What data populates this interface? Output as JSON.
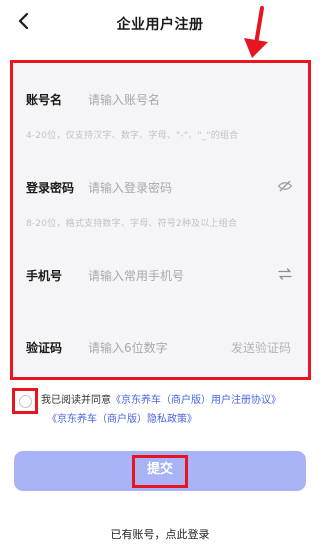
{
  "header": {
    "title": "企业用户注册"
  },
  "form": {
    "account": {
      "label": "账号名",
      "placeholder": "请输入账号名",
      "hint": "4-20位，仅支持汉字、数字、字母、\"-\"、\"_\"的组合"
    },
    "password": {
      "label": "登录密码",
      "placeholder": "请输入登录密码",
      "hint": "8-20位，格式支持数字、字母、符号2种及以上组合"
    },
    "phone": {
      "label": "手机号",
      "placeholder": "请输入常用手机号"
    },
    "code": {
      "label": "验证码",
      "placeholder": "请输入6位数字",
      "send_label": "发送验证码"
    }
  },
  "agreement": {
    "prefix": "我已阅读并同意",
    "link1": "《京东养车（商户版）用户注册协议》",
    "link2": "《京东养车（商户版）隐私政策》"
  },
  "submit_label": "提交",
  "login_link": "已有账号，点此登录",
  "colors": {
    "accent": "#4b64e6",
    "submit_bg": "#a9b4f7",
    "annotation": "#e8141f"
  }
}
